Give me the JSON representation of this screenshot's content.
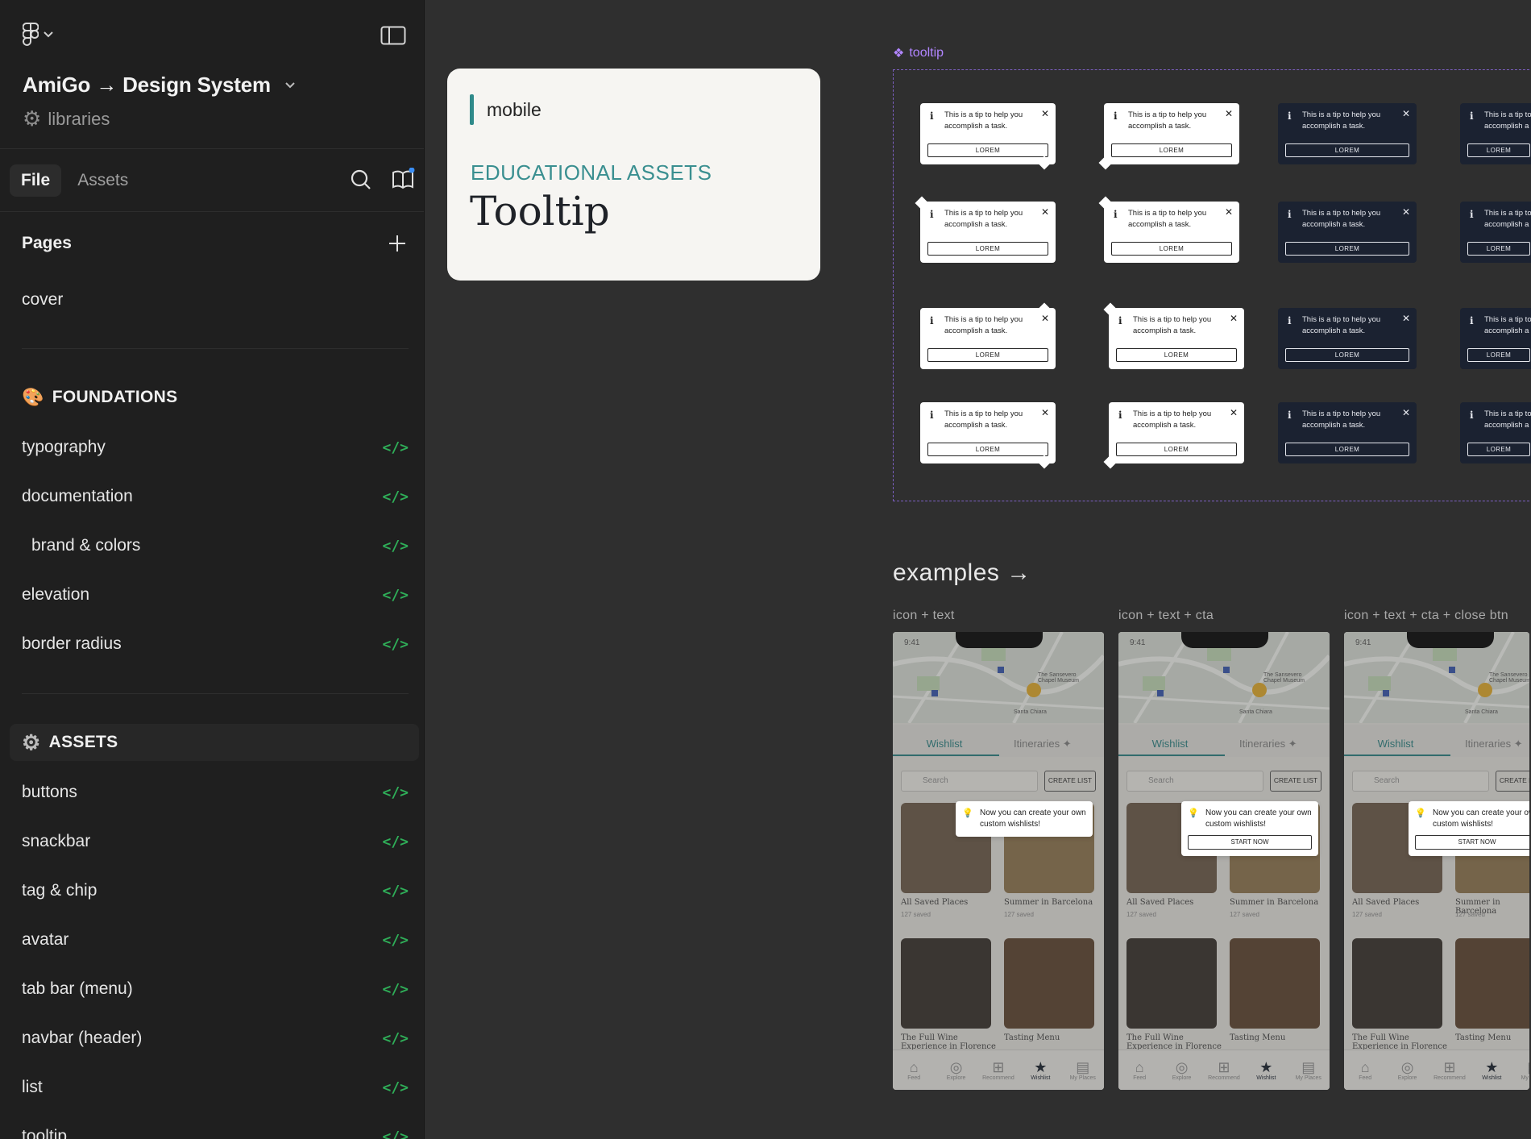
{
  "sidebar": {
    "file_title": "AmiGo → Design System",
    "library_label": "libraries",
    "tabs": [
      {
        "label": "File"
      },
      {
        "label": "Assets"
      }
    ],
    "pages_title": "Pages",
    "cover": "cover",
    "foundations_title": "FOUNDATIONS",
    "foundations": [
      {
        "label": "typography"
      },
      {
        "label": "documentation"
      },
      {
        "label": "brand & colors"
      },
      {
        "label": "elevation"
      },
      {
        "label": "border radius"
      }
    ],
    "assets_title": "ASSETS",
    "assets": [
      {
        "label": "buttons"
      },
      {
        "label": "snackbar"
      },
      {
        "label": "tag & chip"
      },
      {
        "label": "avatar"
      },
      {
        "label": "tab bar (menu)"
      },
      {
        "label": "navbar (header)"
      },
      {
        "label": "list"
      },
      {
        "label": "tooltip"
      }
    ],
    "code_glyph": "</>",
    "icons": [
      "figma-logo-icon",
      "chevron-down-icon",
      "sidebar-toggle-icon",
      "gear-icon",
      "search-icon",
      "book-icon",
      "plus-icon",
      "palette-emoji-icon",
      "code-icon"
    ]
  },
  "canvas": {
    "hero": {
      "platform": "mobile",
      "kicker": "EDUCATIONAL ASSETS",
      "title": "Tooltip"
    },
    "component_label": "tooltip",
    "tooltip_text": "This is a tip to help you accomplish a task.",
    "tooltip_cta": "LOREM",
    "tooltip_icon": "i",
    "tooltip_close": "✕",
    "examples_title": "examples →",
    "example_labels": [
      "icon + text",
      "icon + text + cta",
      "icon + text + cta + close btn"
    ],
    "phone": {
      "time": "9:41",
      "tab_wishlist": "Wishlist",
      "tab_itineraries": "Itineraries ✦",
      "search_placeholder": "Search",
      "create_list": "CREATE LIST",
      "card1_title": "All Saved Places",
      "card1_sub": "127 saved",
      "card2_title": "Summer in Barcelona",
      "card2_sub": "127 saved",
      "card3_title": "The Full Wine Experience in Florence",
      "card4_title": "Tasting Menu",
      "map_place1": "The Sansevero Chapel Museum",
      "map_place2": "Santa Chiara",
      "tip_short": "Now you can create your own custom wishlists!",
      "start_now": "START NOW",
      "nav": [
        "Feed",
        "Explore",
        "Recommend",
        "Wishlist",
        "My Places"
      ]
    }
  },
  "colors": {
    "sidebar_bg": "#1f1f1f",
    "canvas_bg": "#2f2f2f",
    "accent_teal": "#2f8a8a",
    "component_purple": "#b185ff",
    "code_green": "#2fae58",
    "tooltip_dark": "#1b2231"
  }
}
